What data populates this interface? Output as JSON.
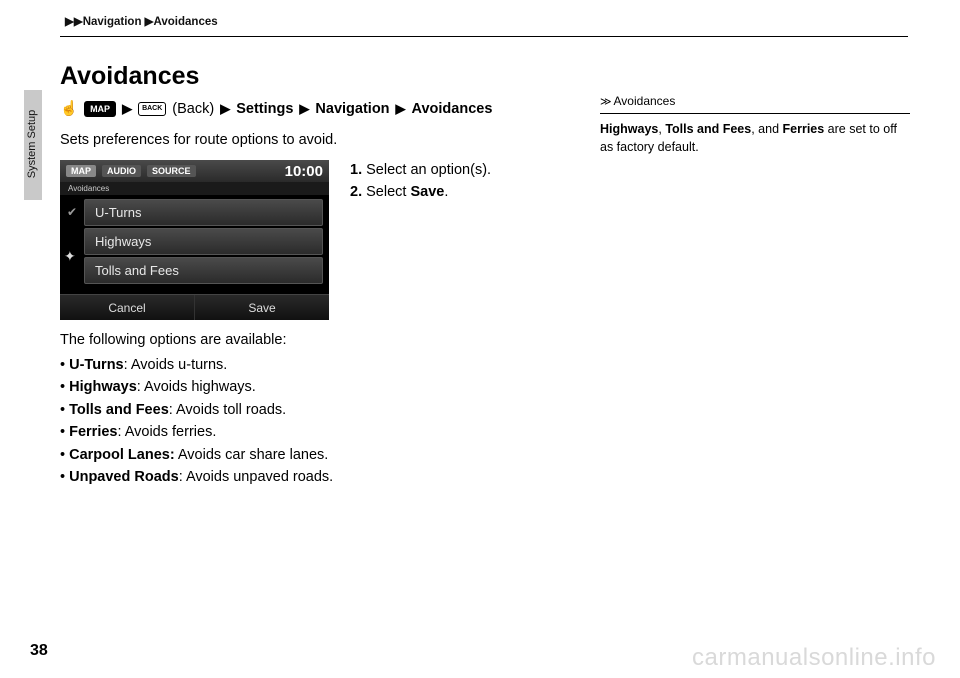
{
  "header": {
    "breadcrumb": "▶▶Navigation ▶Avoidances"
  },
  "side_tab": "System Setup",
  "title": "Avoidances",
  "nav_path": {
    "map_button": "MAP",
    "back_button": "BACK",
    "back_text": "(Back)",
    "settings": "Settings",
    "navigation": "Navigation",
    "avoidances": "Avoidances"
  },
  "intro": "Sets preferences for route options to avoid.",
  "screen": {
    "tabs": {
      "map": "MAP",
      "audio": "AUDIO",
      "source": "SOURCE"
    },
    "clock": "10:00",
    "crumb": "Avoidances",
    "rows": [
      "U-Turns",
      "Highways",
      "Tolls and Fees"
    ],
    "cancel": "Cancel",
    "save": "Save"
  },
  "steps": [
    {
      "n": "1.",
      "text_a": "Select an option(s)."
    },
    {
      "n": "2.",
      "text_a": "Select ",
      "bold": "Save",
      "text_b": "."
    }
  ],
  "options_intro": "The following options are available:",
  "options": [
    {
      "bold": "U-Turns",
      "rest": ": Avoids u-turns."
    },
    {
      "bold": "Highways",
      "rest": ": Avoids highways."
    },
    {
      "bold": "Tolls and Fees",
      "rest": ": Avoids toll roads."
    },
    {
      "bold": "Ferries",
      "rest": ": Avoids ferries."
    },
    {
      "bold": "Carpool Lanes:",
      "rest": " Avoids car share lanes."
    },
    {
      "bold": "Unpaved Roads",
      "rest": ": Avoids unpaved roads."
    }
  ],
  "note": {
    "head": "Avoidances",
    "b1": "Highways",
    "sep1": ", ",
    "b2": "Tolls and Fees",
    "sep2": ", and ",
    "b3": "Ferries",
    "tail": " are set to off as factory default."
  },
  "page_number": "38",
  "watermark": "carmanualsonline.info"
}
